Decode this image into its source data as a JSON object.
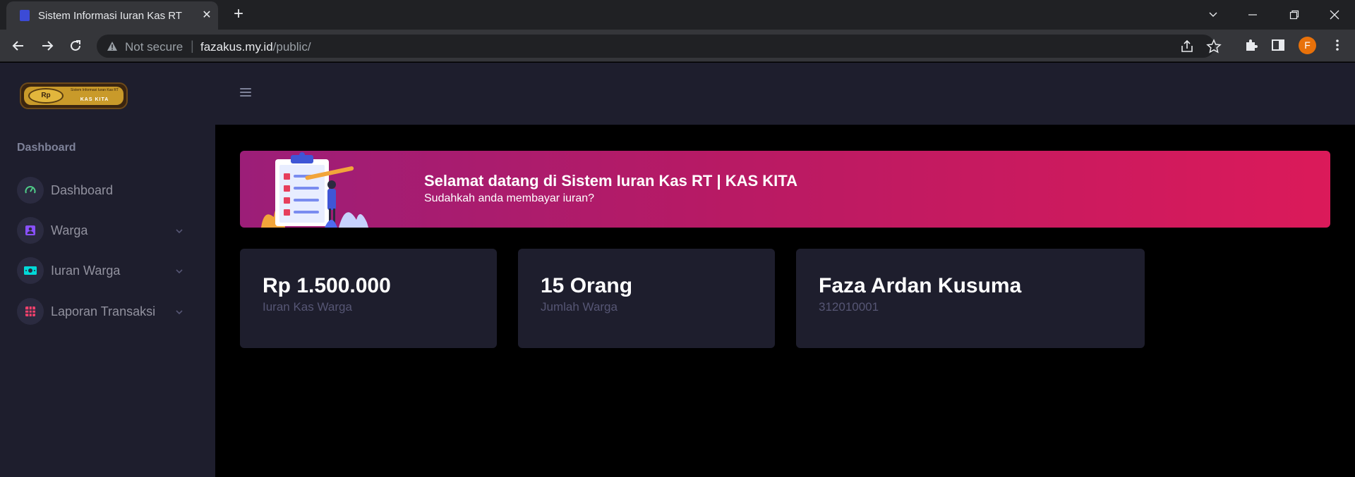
{
  "browser": {
    "tab_title": "Sistem Informasi Iuran Kas RT",
    "security_label": "Not secure",
    "url_host": "fazakus.my.id",
    "url_path": "/public/",
    "profile_initial": "F"
  },
  "sidebar": {
    "logo_text": "Sistem Informasi Iuran Kas RT",
    "logo_coin": "Rp",
    "logo_brand": "KAS KITA",
    "section_title": "Dashboard",
    "items": [
      {
        "label": "Dashboard",
        "icon": "gauge-icon",
        "color": "#50cd89"
      },
      {
        "label": "Warga",
        "icon": "user-card-icon",
        "color": "#8950fc"
      },
      {
        "label": "Iuran Warga",
        "icon": "money-icon",
        "color": "#00d9d9"
      },
      {
        "label": "Laporan Transaksi",
        "icon": "table-icon",
        "color": "#f1416c"
      }
    ]
  },
  "banner": {
    "title": "Selamat datang di Sistem Iuran Kas RT | KAS KITA",
    "subtitle": "Sudahkah anda membayar iuran?"
  },
  "cards": [
    {
      "value": "Rp 1.500.000",
      "label": "Iuran Kas Warga"
    },
    {
      "value": "15 Orang",
      "label": "Jumlah Warga"
    },
    {
      "value": "Faza Ardan Kusuma",
      "label": "312010001"
    }
  ]
}
